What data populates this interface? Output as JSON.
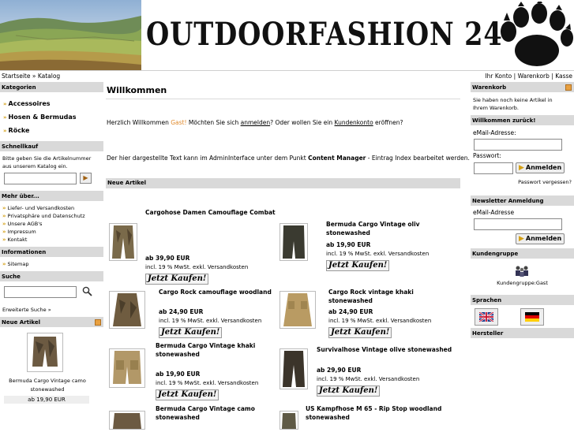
{
  "header": {
    "logo_text": "OUTDOORFASHION 24"
  },
  "nav": {
    "breadcrumb": "Startseite » Katalog",
    "links": [
      "Ihr Konto",
      "Warenkorb",
      "Kasse"
    ]
  },
  "left": {
    "kategorien_title": "Kategorien",
    "categories": [
      "Accessoires",
      "Hosen & Bermudas",
      "Röcke"
    ],
    "schnellkauf_title": "Schnellkauf",
    "schnellkauf_text_1": "Bitte geben Sie die Artikelnummer",
    "schnellkauf_text_2": "aus unserem Katalog ein.",
    "mehr_title": "Mehr über...",
    "mehr_items": [
      "Liefer- und Versandkosten",
      "Privatsphäre und Datenschutz",
      "Unsere AGB's",
      "Impressum",
      "Kontakt"
    ],
    "info_title": "Informationen",
    "info_items": [
      "Sitemap"
    ],
    "suche_title": "Suche",
    "erweiterte_suche": "Erweiterte Suche »",
    "neue_artikel_title": "Neue Artikel",
    "neue_artikel_name_1": "Bermuda Cargo Vintage camo",
    "neue_artikel_name_2": "stonewashed",
    "neue_artikel_price": "ab 19,90 EUR"
  },
  "main": {
    "title": "Willkommen",
    "greeting_1": "Herzlich Willkommen ",
    "guest": "Gast!",
    "greeting_2": " Möchten Sie sich ",
    "login_link": "anmelden",
    "greeting_3": "? Oder wollen Sie ein ",
    "account_link": "Kundenkonto",
    "greeting_4": " eröffnen?",
    "admin_text_1": "Der hier dargestellte Text kann im AdminInterface unter dem Punkt ",
    "admin_text_bold": "Content Manager",
    "admin_text_2": " - Eintrag Index bearbeitet werden.",
    "neue_artikel_title": "Neue Artikel",
    "buy_label": "Jetzt Kaufen!",
    "tax_note": "incl. 19 % MwSt. exkl. Versandkosten",
    "products": [
      {
        "title": "Cargohose Damen Camouflage Combat",
        "price": "ab 39,90 EUR",
        "color": "#7a6a4a"
      },
      {
        "title": "Bermuda Cargo Vintage oliv stonewashed",
        "price": "ab 19,90 EUR",
        "color": "#3a3a30"
      },
      {
        "title": "Cargo Rock camouflage woodland",
        "price": "ab 24,90 EUR",
        "color": "#6f5c40"
      },
      {
        "title": "Cargo Rock vintage khaki stonewashed",
        "price": "ab 24,90 EUR",
        "color": "#b99b63"
      },
      {
        "title": "Bermuda Cargo Vintage khaki stonewashed",
        "price": "ab 19,90 EUR",
        "color": "#b29868"
      },
      {
        "title": "Survivalhose Vintage olive stonewashed",
        "price": "ab 29,90 EUR",
        "color": "#3b342a"
      },
      {
        "title": "Bermuda Cargo Vintage camo stonewashed",
        "price": "",
        "color": "#6c5a42"
      },
      {
        "title": "US Kampfhose M 65 - Rip Stop woodland stonewashed",
        "price": "",
        "color": "#5f5a46"
      }
    ]
  },
  "right": {
    "warenkorb_title": "Warenkorb",
    "warenkorb_text_1": "Sie haben noch keine Artikel in",
    "warenkorb_text_2": "Ihrem Warenkorb.",
    "willkommen_title": "Willkommen zurück!",
    "email_label": "eMail-Adresse:",
    "password_label": "Passwort:",
    "login_button": "Anmelden",
    "forgot_password": "Passwort vergessen?",
    "newsletter_title": "Newsletter Anmeldung",
    "newsletter_email_label": "eMail-Adresse",
    "newsletter_button": "Anmelden",
    "kundengruppe_title": "Kundengruppe",
    "kundengruppe_value": "Kundengruppe:Gast",
    "sprachen_title": "Sprachen",
    "hersteller_title": "Hersteller"
  },
  "colors": {
    "box_header": "#d9d9d9",
    "arrow": "#d4a017",
    "guest": "#e08a2c"
  }
}
